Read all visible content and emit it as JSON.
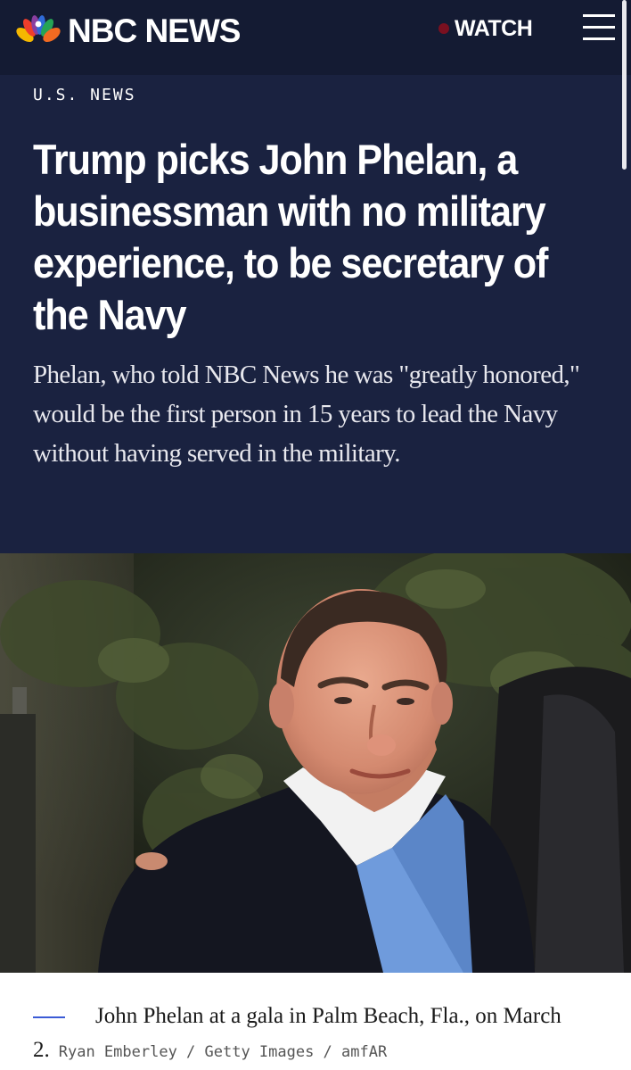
{
  "header": {
    "logo_text": "NBC NEWS",
    "watch_label": "WATCH"
  },
  "article": {
    "section": "U.S. NEWS",
    "headline": "Trump picks John Phelan, a businessman with no military experience, to be secretary of the Navy",
    "dek": "Phelan, who told NBC News he was \"greatly honored,\" would be the first person in 15 years to lead the Navy without having served in the military."
  },
  "photo": {
    "caption": "John Phelan at a gala in Palm Beach, Fla., on March 2.",
    "credit": "Ryan Emberley / Getty Images / amfAR"
  },
  "colors": {
    "hero_background": "#1a2240",
    "topbar_background": "#141b33",
    "live_dot": "#7a1020",
    "caption_rule": "#3b5bd6"
  },
  "icons": [
    "nbc-peacock-logo-icon",
    "live-dot-icon",
    "hamburger-menu-icon"
  ]
}
